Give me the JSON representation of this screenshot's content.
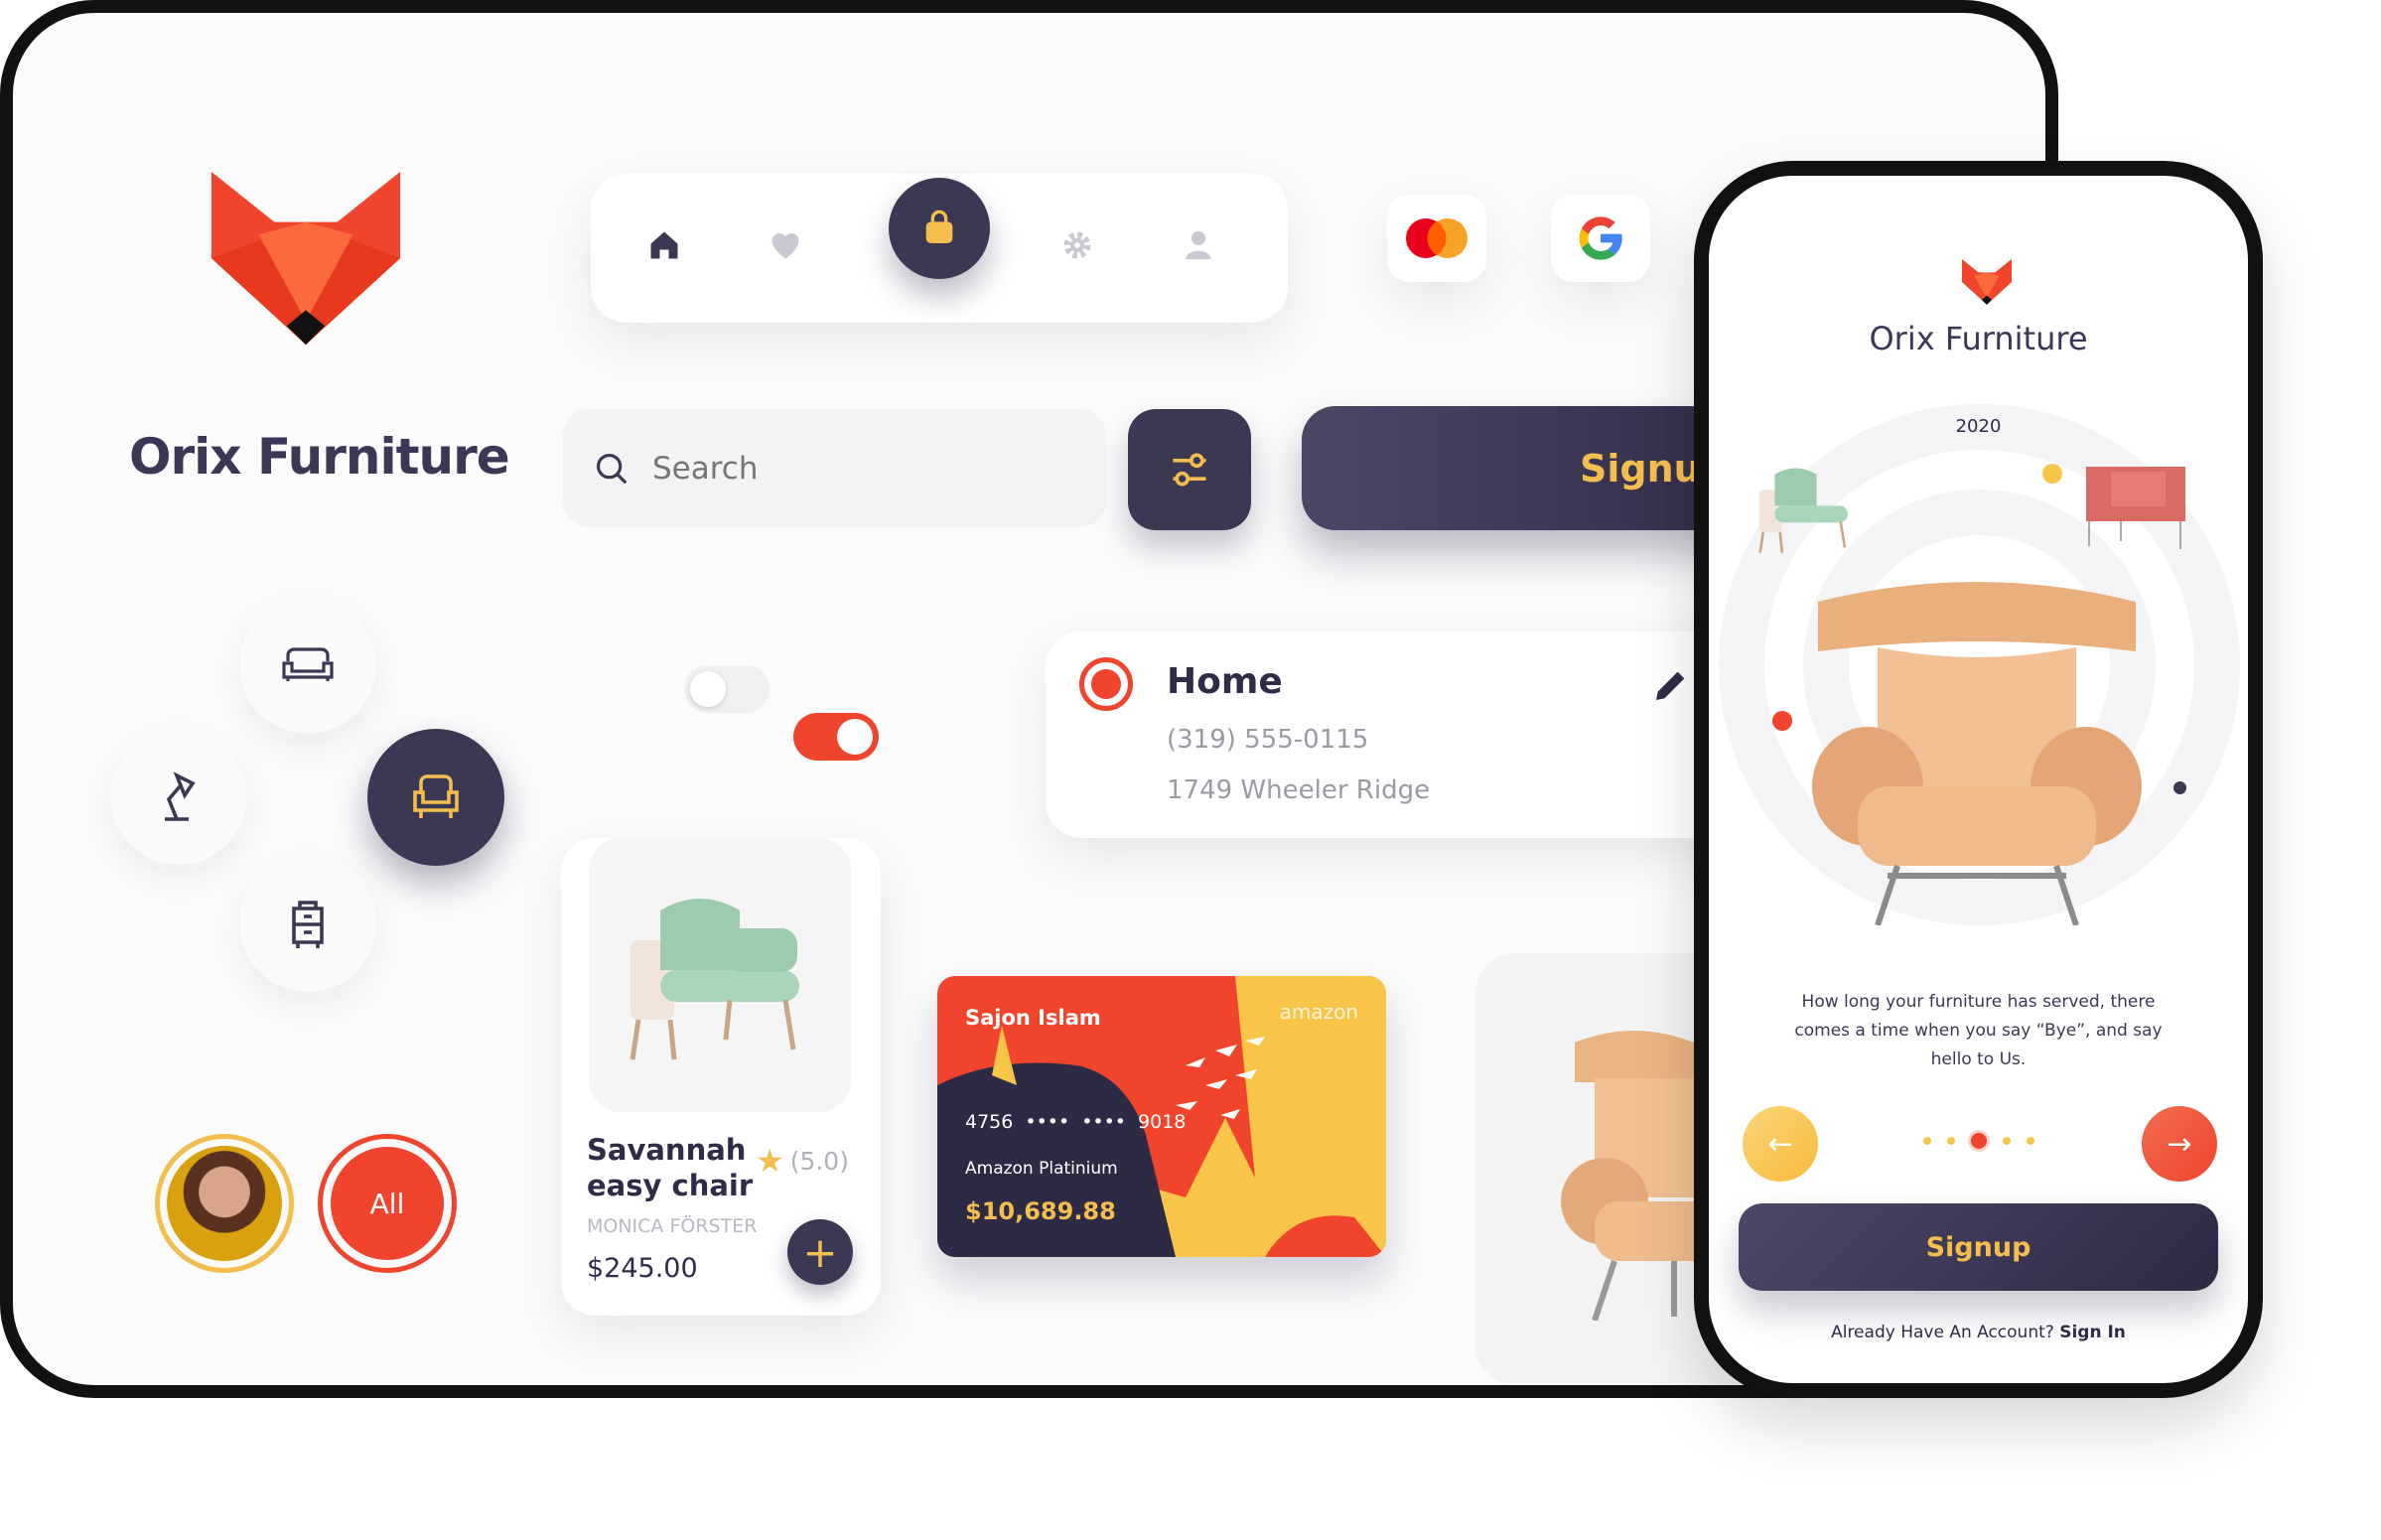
{
  "brand": {
    "name": "Orix Furniture",
    "logo": "fox-head-logo",
    "accent": "#f0442d",
    "dark": "#3b3854",
    "gold": "#f4be4f"
  },
  "nav": {
    "items": [
      {
        "icon": "home-icon"
      },
      {
        "icon": "heart-icon"
      },
      {
        "icon": "shopping-bag-icon",
        "active": true
      },
      {
        "icon": "gear-icon"
      },
      {
        "icon": "user-icon"
      }
    ]
  },
  "payments": {
    "mastercard": "mastercard-logo",
    "google": "google-logo"
  },
  "search": {
    "placeholder": "Search"
  },
  "signup": {
    "label": "Signup"
  },
  "categories": [
    {
      "icon": "sofa-icon"
    },
    {
      "icon": "lamp-icon"
    },
    {
      "icon": "armchair-icon",
      "active": true
    },
    {
      "icon": "cabinet-icon"
    }
  ],
  "toggles": [
    {
      "on": false
    },
    {
      "on": true
    }
  ],
  "address": {
    "label": "Home",
    "phone": "(319) 555-0115",
    "street": "1749 Wheeler Ridge"
  },
  "product": {
    "name_line1": "Savannah",
    "name_line2": "easy chair",
    "rating": "(5.0)",
    "designer": "MONICA FÖRSTER",
    "price": "$245.00"
  },
  "credit_card": {
    "holder": "Sajon Islam",
    "brand": "amazon",
    "number_start": "4756",
    "number_mask1": "••••",
    "number_mask2": "••••",
    "number_end": "9018",
    "type": "Amazon Platinium",
    "balance": "$10,689.88"
  },
  "filter": {
    "all_label": "All"
  },
  "phone": {
    "title": "Orix Furniture",
    "year": "2020",
    "description": "How long your furniture has served, there comes a time when you say “Bye”, and say hello to Us.",
    "pager": {
      "count": 5,
      "active": 3
    },
    "signup_label": "Signup",
    "account_prompt": "Already Have An Account?",
    "signin_label": "Sign In"
  }
}
